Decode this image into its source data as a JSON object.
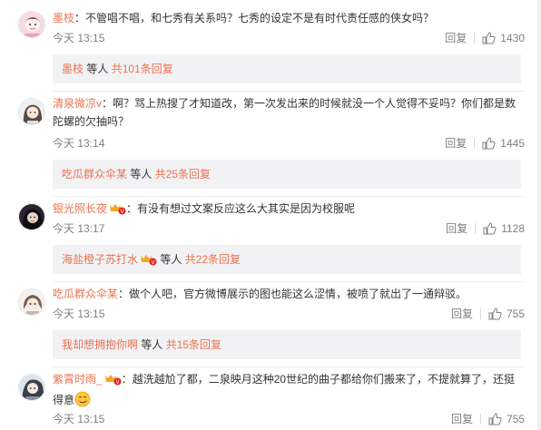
{
  "comments": [
    {
      "username": "墨枝",
      "colon": "：",
      "text": "不管唱不唱，和七秀有关系吗？七秀的设定不是有时代责任感的侠女吗？",
      "time": "今天 13:15",
      "reply_label": "回复",
      "likes": "1430",
      "sub": {
        "user": "墨枝",
        "middle": " 等人 ",
        "total": "共101条回复"
      }
    },
    {
      "username": "清泉微凉v",
      "colon": "：",
      "text": "啊？骂上热搜了才知道改，第一次发出来的时候就没一个人觉得不妥吗？你们都是数陀螺的欠抽吗？",
      "time": "今天 13:14",
      "reply_label": "回复",
      "likes": "1445",
      "sub": {
        "user": "吃瓜群众伞某",
        "middle": " 等人 ",
        "total": "共25条回复"
      }
    },
    {
      "username": "银光照长夜",
      "colon": "：",
      "text": "有没有想过文案反应这么大其实是因为校服呢",
      "time": "今天 13:17",
      "reply_label": "回复",
      "likes": "1128",
      "sub": {
        "user": "海盐橙子苏打水",
        "middle": " 等人 ",
        "total": "共22条回复"
      }
    },
    {
      "username": "吃瓜群众伞某",
      "colon": "：",
      "text": "做个人吧，官方微博展示的图也能这么涩情，被喷了就出了一通辩驳。",
      "time": "今天 13:15",
      "reply_label": "回复",
      "likes": "755",
      "sub": {
        "user": "我却想拥抱你啊",
        "middle": " 等人 ",
        "total": "共15条回复"
      }
    },
    {
      "username": "紫霄时雨_",
      "colon": "：",
      "text": "越洗越尬了都，二泉映月这种20世纪的曲子都给你们搬来了，不提就算了，还挺得意",
      "time": "今天 13:15",
      "reply_label": "回复",
      "likes": "755"
    }
  ],
  "colors": {
    "username": "#eb7350",
    "meta": "#808080",
    "subbox_bg": "#f2f2f5"
  },
  "icons": {
    "like": "thumbs-up-icon",
    "vip": "vip-badge-icon",
    "emoji": "smug-face-emoji"
  }
}
